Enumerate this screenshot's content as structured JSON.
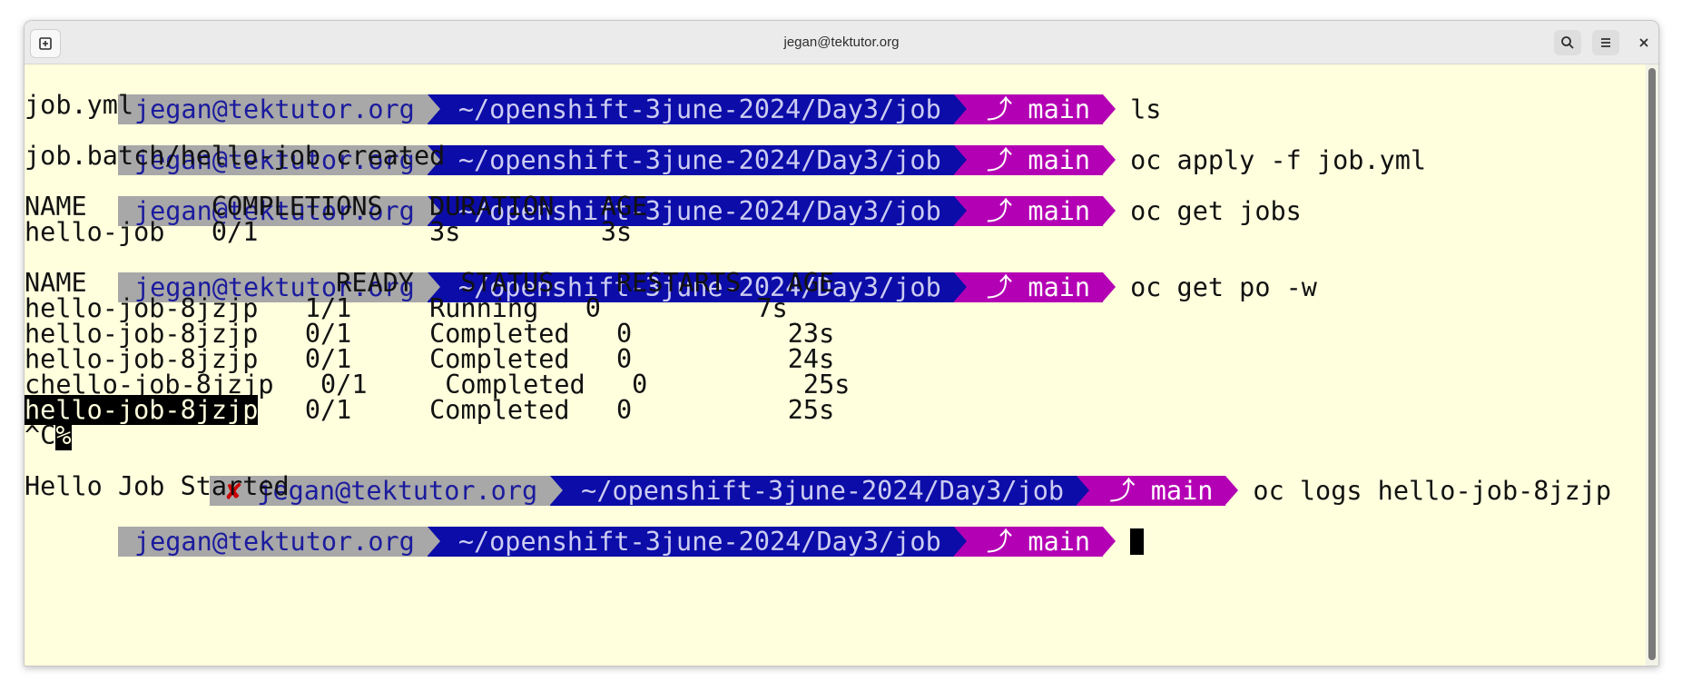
{
  "window": {
    "title": "jegan@tektutor.org"
  },
  "prompt": {
    "user": "jegan@tektutor.org",
    "path": "~/openshift-3june-2024/Day3/job",
    "git_icon": "⤴",
    "branch": "main",
    "error_icon": "✘"
  },
  "lines": {
    "l0_cmd": "ls",
    "l1": "job.yml",
    "l2_cmd": "oc apply -f job.yml",
    "l3": "job.batch/hello-job created",
    "l4_cmd": "oc get jobs",
    "l5": "NAME        COMPLETIONS   DURATION   AGE",
    "l6": "hello-job   0/1           3s         3s",
    "l7_cmd": "oc get po -w",
    "l8": "NAME                READY   STATUS    RESTARTS   AGE",
    "l9": "hello-job-8jzjp   1/1     Running   0          7s",
    "l10": "hello-job-8jzjp   0/1     Completed   0          23s",
    "l11": "hello-job-8jzjp   0/1     Completed   0          24s",
    "l12": "chello-job-8jzjp   0/1     Completed   0          25s",
    "l13_sel": "hello-job-8jzjp",
    "l13_rest": "   0/1     Completed   0          25s",
    "l14_a": "^C",
    "l14_b": "%",
    "l15_cmd": "oc logs hello-job-8jzjp",
    "l16": "Hello Job Started"
  },
  "colors": {
    "terminal_bg": "#ffffde",
    "user_seg": "#a8a8a8",
    "path_seg": "#0c0ca8",
    "git_seg": "#b400b4",
    "error_mark": "#cc0000"
  }
}
